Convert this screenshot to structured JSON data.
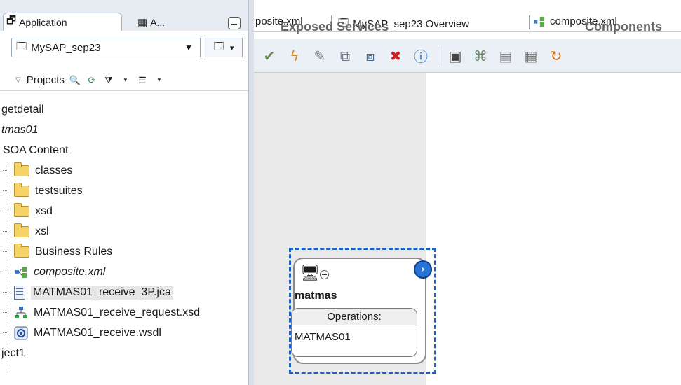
{
  "navigator": {
    "tabs": [
      {
        "label": "Application"
      },
      {
        "label": "A..."
      }
    ],
    "application_select": {
      "value": "MySAP_sep23"
    },
    "projects_label": "Projects",
    "tree": [
      {
        "label": "getdetail",
        "italic": false
      },
      {
        "label": "tmas01",
        "italic": true
      },
      {
        "label": "SOA Content",
        "italic": false
      },
      {
        "label": "classes",
        "icon": "folder-icon"
      },
      {
        "label": "testsuites",
        "icon": "folder-icon"
      },
      {
        "label": "xsd",
        "icon": "folder-icon"
      },
      {
        "label": "xsl",
        "icon": "folder-icon"
      },
      {
        "label": "Business Rules",
        "icon": "folder-icon"
      },
      {
        "label": "composite.xml",
        "icon": "composite-icon",
        "italic": true
      },
      {
        "label": "MATMAS01_receive_3P.jca",
        "icon": "document-icon",
        "selected": true
      },
      {
        "label": "MATMAS01_receive_request.xsd",
        "icon": "schema-icon"
      },
      {
        "label": "MATMAS01_receive.wsdl",
        "icon": "wsdl-icon"
      },
      {
        "label": "ject1",
        "italic": false
      }
    ]
  },
  "editor": {
    "tabs": [
      {
        "label": "posite.xml"
      },
      {
        "label": "MySAP_sep23 Overview"
      },
      {
        "label": "composite.xml"
      }
    ],
    "swimlanes": {
      "exposed_services": "Exposed Services",
      "components": "Components"
    },
    "service": {
      "name": "matmas",
      "operations_label": "Operations:",
      "operations": [
        "MATMAS01"
      ]
    }
  },
  "colors": {
    "selection_border": "#1f5fc4",
    "go_button": "#2a73d6",
    "folder": "#f5d36b",
    "exposed_lane_bg": "#e9e9e9"
  }
}
